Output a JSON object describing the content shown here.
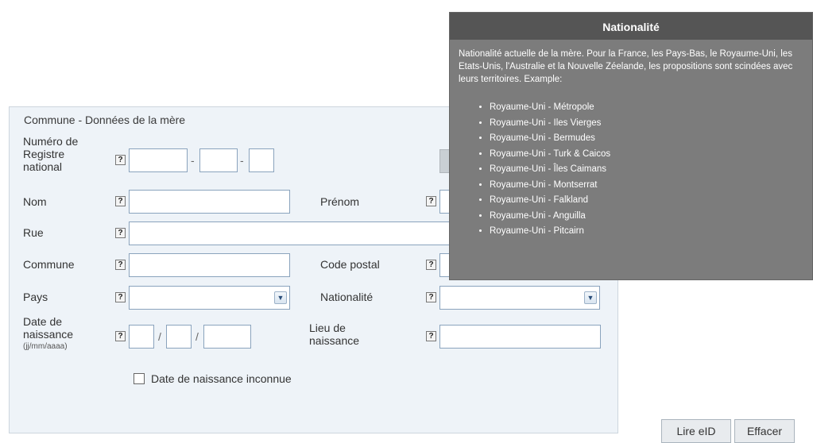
{
  "panel": {
    "title": "Commune - Données de la mère"
  },
  "fields": {
    "registre_label": "Numéro de Registre national",
    "nom_label": "Nom",
    "prenom_label": "Prénom",
    "rue_label": "Rue",
    "commune_label": "Commune",
    "code_postal_label": "Code postal",
    "pays_label": "Pays",
    "nationalite_label": "Nationalité",
    "date_naissance_label": "Date de naissance",
    "date_naissance_hint": "(jj/mm/aaaa)",
    "lieu_naissance_label": "Lieu de naissance",
    "date_inconnue_label": "Date de naissance inconnue",
    "help_glyph": "?",
    "sep_dash": "-",
    "sep_slash": "/"
  },
  "buttons": {
    "lire_eid": "Lire eID",
    "effacer": "Effacer"
  },
  "tooltip": {
    "title": "Nationalité",
    "text": "Nationalité actuelle de la mère. Pour la France, les Pays-Bas, le Royaume-Uni, les Etats-Unis, l'Australie et la Nouvelle Zéelande, les propositions sont scindées avec leurs territoires. Example:",
    "items": [
      "Royaume-Uni - Métropole",
      "Royaume-Uni - Iles Vierges",
      "Royaume-Uni - Bermudes",
      "Royaume-Uni - Turk & Caicos",
      "Royaume-Uni - Îles Caimans",
      "Royaume-Uni - Montserrat",
      "Royaume-Uni - Falkland",
      "Royaume-Uni - Anguilla",
      "Royaume-Uni - Pitcairn"
    ]
  },
  "icons": {
    "dropdown": "chevron-down-icon",
    "help": "help-icon"
  },
  "colors": {
    "panel_bg": "#eef3f8",
    "tooltip_bg": "#7c7c7c",
    "tooltip_header": "#555555",
    "input_border": "#8aa3bd"
  }
}
